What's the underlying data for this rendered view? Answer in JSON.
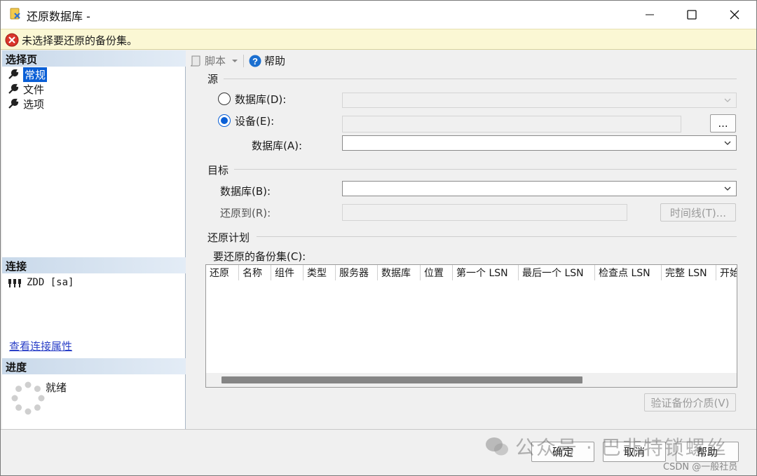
{
  "window": {
    "title": "还原数据库 -"
  },
  "message": {
    "text": "未选择要还原的备份集。"
  },
  "left": {
    "select_page_header": "选择页",
    "pages": [
      {
        "label": "常规",
        "selected": true
      },
      {
        "label": "文件"
      },
      {
        "label": "选项"
      }
    ],
    "connection_header": "连接",
    "connection": "ZDD [sa]",
    "view_connection_link": "查看连接属性",
    "progress_header": "进度",
    "progress_status": "就绪"
  },
  "toolbar": {
    "script_label": "脚本",
    "help_label": "帮助"
  },
  "source": {
    "group_label": "源",
    "database_radio": "数据库(D):",
    "device_radio": "设备(E):",
    "browse_button": "...",
    "database_label": "数据库(A):"
  },
  "destination": {
    "group_label": "目标",
    "database_label": "数据库(B):",
    "restore_to_label": "还原到(R):",
    "timeline_button": "时间线(T)..."
  },
  "plan": {
    "group_label": "还原计划",
    "backup_sets_label": "要还原的备份集(C):",
    "columns": [
      "还原",
      "名称",
      "组件",
      "类型",
      "服务器",
      "数据库",
      "位置",
      "第一个 LSN",
      "最后一个 LSN",
      "检查点 LSN",
      "完整 LSN",
      "开始"
    ],
    "verify_button": "验证备份介质(V)"
  },
  "footer": {
    "ok_button": "确定",
    "cancel_button": "取消",
    "help_button": "帮助"
  },
  "watermark": {
    "text": "公众号 · 巴非特锁螺丝",
    "csdn": "CSDN @一般社员"
  }
}
